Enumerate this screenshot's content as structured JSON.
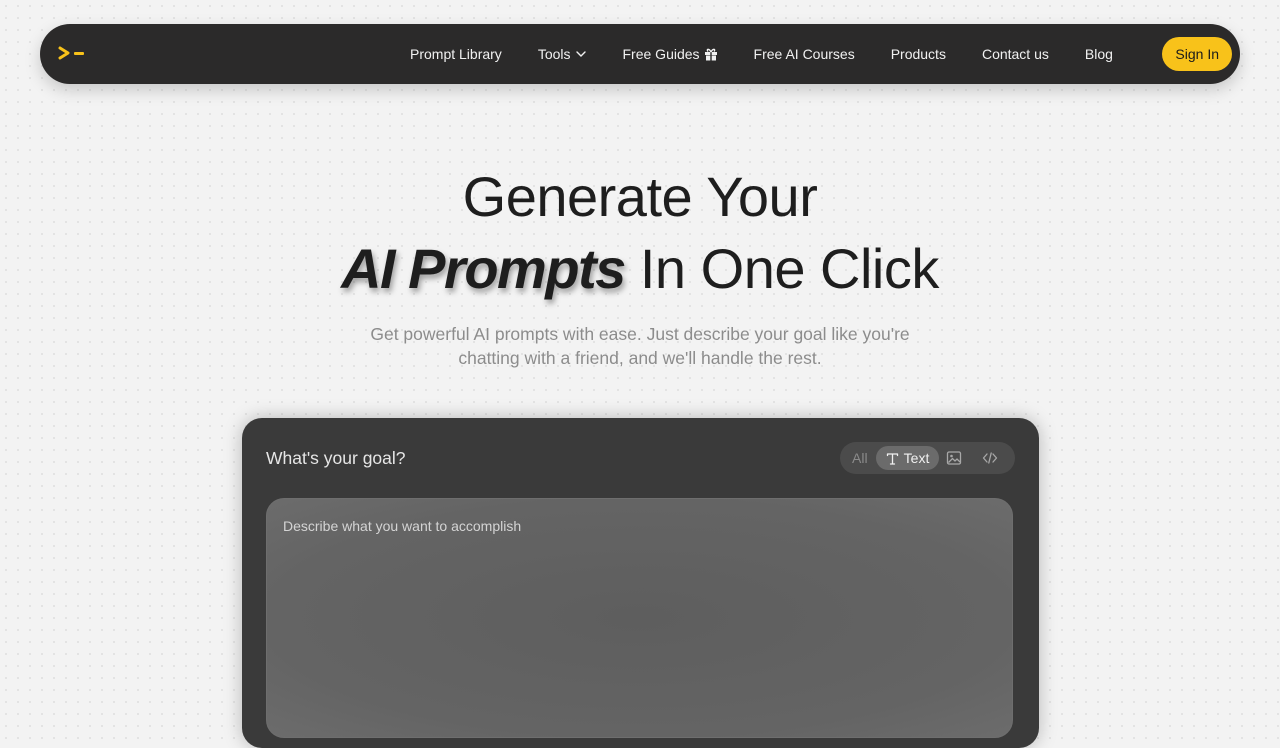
{
  "nav": {
    "logo_icon": "terminal-prompt-icon",
    "links": [
      {
        "label": "Prompt Library"
      },
      {
        "label": "Tools",
        "icon": "chevron-down-icon"
      },
      {
        "label": "Free Guides",
        "icon": "gift-icon"
      },
      {
        "label": "Free AI Courses"
      },
      {
        "label": "Products"
      },
      {
        "label": "Contact us"
      },
      {
        "label": "Blog"
      }
    ],
    "signin_label": "Sign In"
  },
  "hero": {
    "title_line1": "Generate Your",
    "title_emphasis": "AI Prompts",
    "title_line2_rest": "In One Click",
    "subtitle_line1": "Get powerful AI prompts with ease. Just describe your goal like you're",
    "subtitle_line2": "chatting with a friend, and we'll handle the rest."
  },
  "generator": {
    "goal_label": "What's your goal?",
    "modes": {
      "all": "All",
      "text": "Text",
      "text_icon": "text-type-icon",
      "image_icon": "image-icon",
      "code_icon": "code-icon",
      "selected": "Text"
    },
    "input_placeholder": "Describe what you want to accomplish",
    "input_value": ""
  },
  "colors": {
    "accent": "#f8c21a",
    "nav_bg": "#2b2a2a",
    "card_bg": "#3a3a3a",
    "page_bg": "#f3f3f3"
  }
}
